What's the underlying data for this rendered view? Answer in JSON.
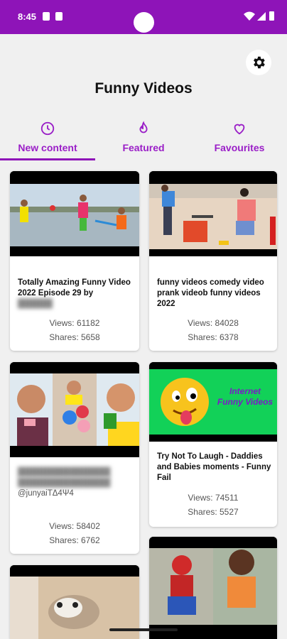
{
  "status": {
    "time": "8:45"
  },
  "header": {
    "title": "Funny Videos",
    "settings_icon": "gear-icon"
  },
  "tabs": [
    {
      "label": "New content",
      "icon": "clock-icon",
      "active": true
    },
    {
      "label": "Featured",
      "icon": "fire-icon"
    },
    {
      "label": "Favourites",
      "icon": "heart-icon"
    }
  ],
  "videos": [
    {
      "title": "Totally Amazing Funny Video 2022 Episode 29 by",
      "title_blurred": "██████",
      "views_label": "Views: 61182",
      "shares_label": "Shares: 5658"
    },
    {
      "title": "funny videos comedy video prank videob  funny videos 2022",
      "views_label": "Views: 84028",
      "shares_label": "Shares: 6378"
    },
    {
      "title_blurred": "████████████████",
      "subtitle_partial": "@junyaiTΔ4Ψ4",
      "views_label": "Views: 58402",
      "shares_label": "Shares: 6762"
    },
    {
      "thumb_text_1": "Internet",
      "thumb_text_2": "Funny Videos",
      "title": "Try Not To Laugh -  Daddies and Babies moments - Funny Fail",
      "views_label": "Views: 74511",
      "shares_label": "Shares: 5527"
    }
  ],
  "colors": {
    "accent": "#8e14b8",
    "tab_text": "#9a1ec7",
    "background": "#f0f0f0"
  }
}
